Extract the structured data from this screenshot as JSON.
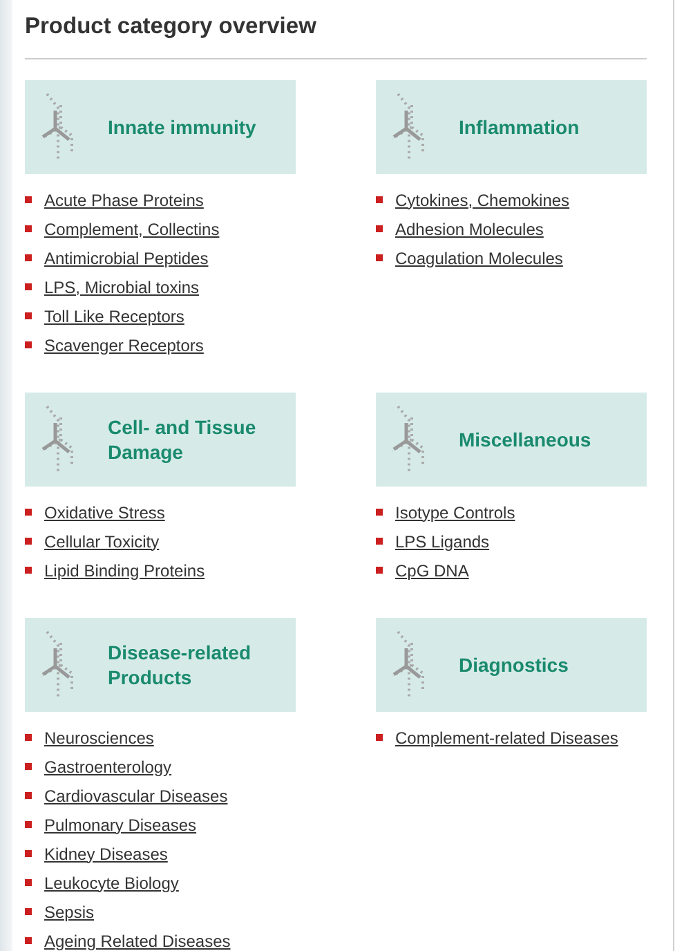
{
  "title": "Product category overview",
  "categories": [
    {
      "name": "Innate immunity",
      "links": [
        "Acute Phase Proteins",
        "Complement, Collectins",
        "Antimicrobial Peptides",
        "LPS, Microbial toxins",
        "Toll Like Receptors",
        "Scavenger Receptors"
      ]
    },
    {
      "name": "Inflammation",
      "links": [
        "Cytokines, Chemokines",
        "Adhesion Molecules",
        "Coagulation Molecules"
      ]
    },
    {
      "name": "Cell- and Tissue Damage",
      "links": [
        "Oxidative Stress",
        "Cellular Toxicity",
        "Lipid Binding Proteins"
      ]
    },
    {
      "name": "Miscellaneous",
      "links": [
        "Isotype Controls",
        "LPS Ligands",
        "CpG DNA"
      ]
    },
    {
      "name": "Disease-related Products",
      "links": [
        "Neurosciences",
        "Gastroenterology",
        "Cardiovascular Diseases",
        "Pulmonary Diseases",
        "Kidney Diseases",
        "Leukocyte Biology",
        "Sepsis",
        "Ageing Related Diseases"
      ]
    },
    {
      "name": "Diagnostics",
      "links": [
        "Complement-related Diseases"
      ]
    }
  ]
}
